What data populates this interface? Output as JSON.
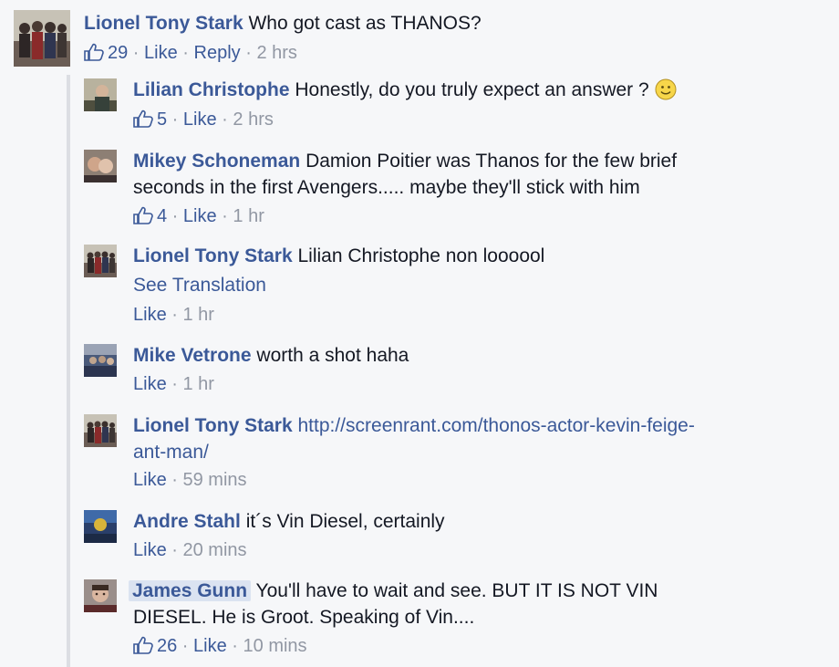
{
  "main_comment": {
    "author": "Lionel Tony Stark",
    "text": "Who got cast as THANOS?",
    "likes": "29",
    "like_label": "Like",
    "reply_label": "Reply",
    "time": "2 hrs"
  },
  "replies": [
    {
      "author": "Lilian Christophe",
      "text": "Honestly, do you truly expect an answer ?",
      "emoji": "smile-emoji",
      "likes": "5",
      "like_label": "Like",
      "time": "2 hrs"
    },
    {
      "author": "Mikey Schoneman",
      "text_line1": "Damion Poitier was Thanos for the few brief",
      "text_line2": "seconds in the first Avengers..... maybe they'll stick with him",
      "likes": "4",
      "like_label": "Like",
      "time": "1 hr"
    },
    {
      "author": "Lionel Tony Stark",
      "text": "Lilian Christophe non loooool",
      "see_translation": "See Translation",
      "like_label": "Like",
      "time": "1 hr"
    },
    {
      "author": "Mike Vetrone",
      "text": "worth a shot haha",
      "like_label": "Like",
      "time": "1 hr"
    },
    {
      "author": "Lionel Tony Stark",
      "link_line1": "http://screenrant.com/thonos-actor-kevin-feige-",
      "link_line2": "ant-man/",
      "like_label": "Like",
      "time": "59 mins"
    },
    {
      "author": "Andre Stahl",
      "text": "it´s Vin Diesel, certainly",
      "like_label": "Like",
      "time": "20 mins"
    },
    {
      "author": "James Gunn",
      "text_line1": "You'll have to wait and see. BUT IT IS NOT VIN",
      "text_line2": "DIESEL. He is Groot. Speaking of Vin....",
      "likes": "26",
      "like_label": "Like",
      "time": "10 mins"
    }
  ],
  "separator": " · ",
  "colors": {
    "name": "#3b5998",
    "meta": "#9197a3",
    "text": "#141823",
    "background": "#f6f7f9"
  }
}
